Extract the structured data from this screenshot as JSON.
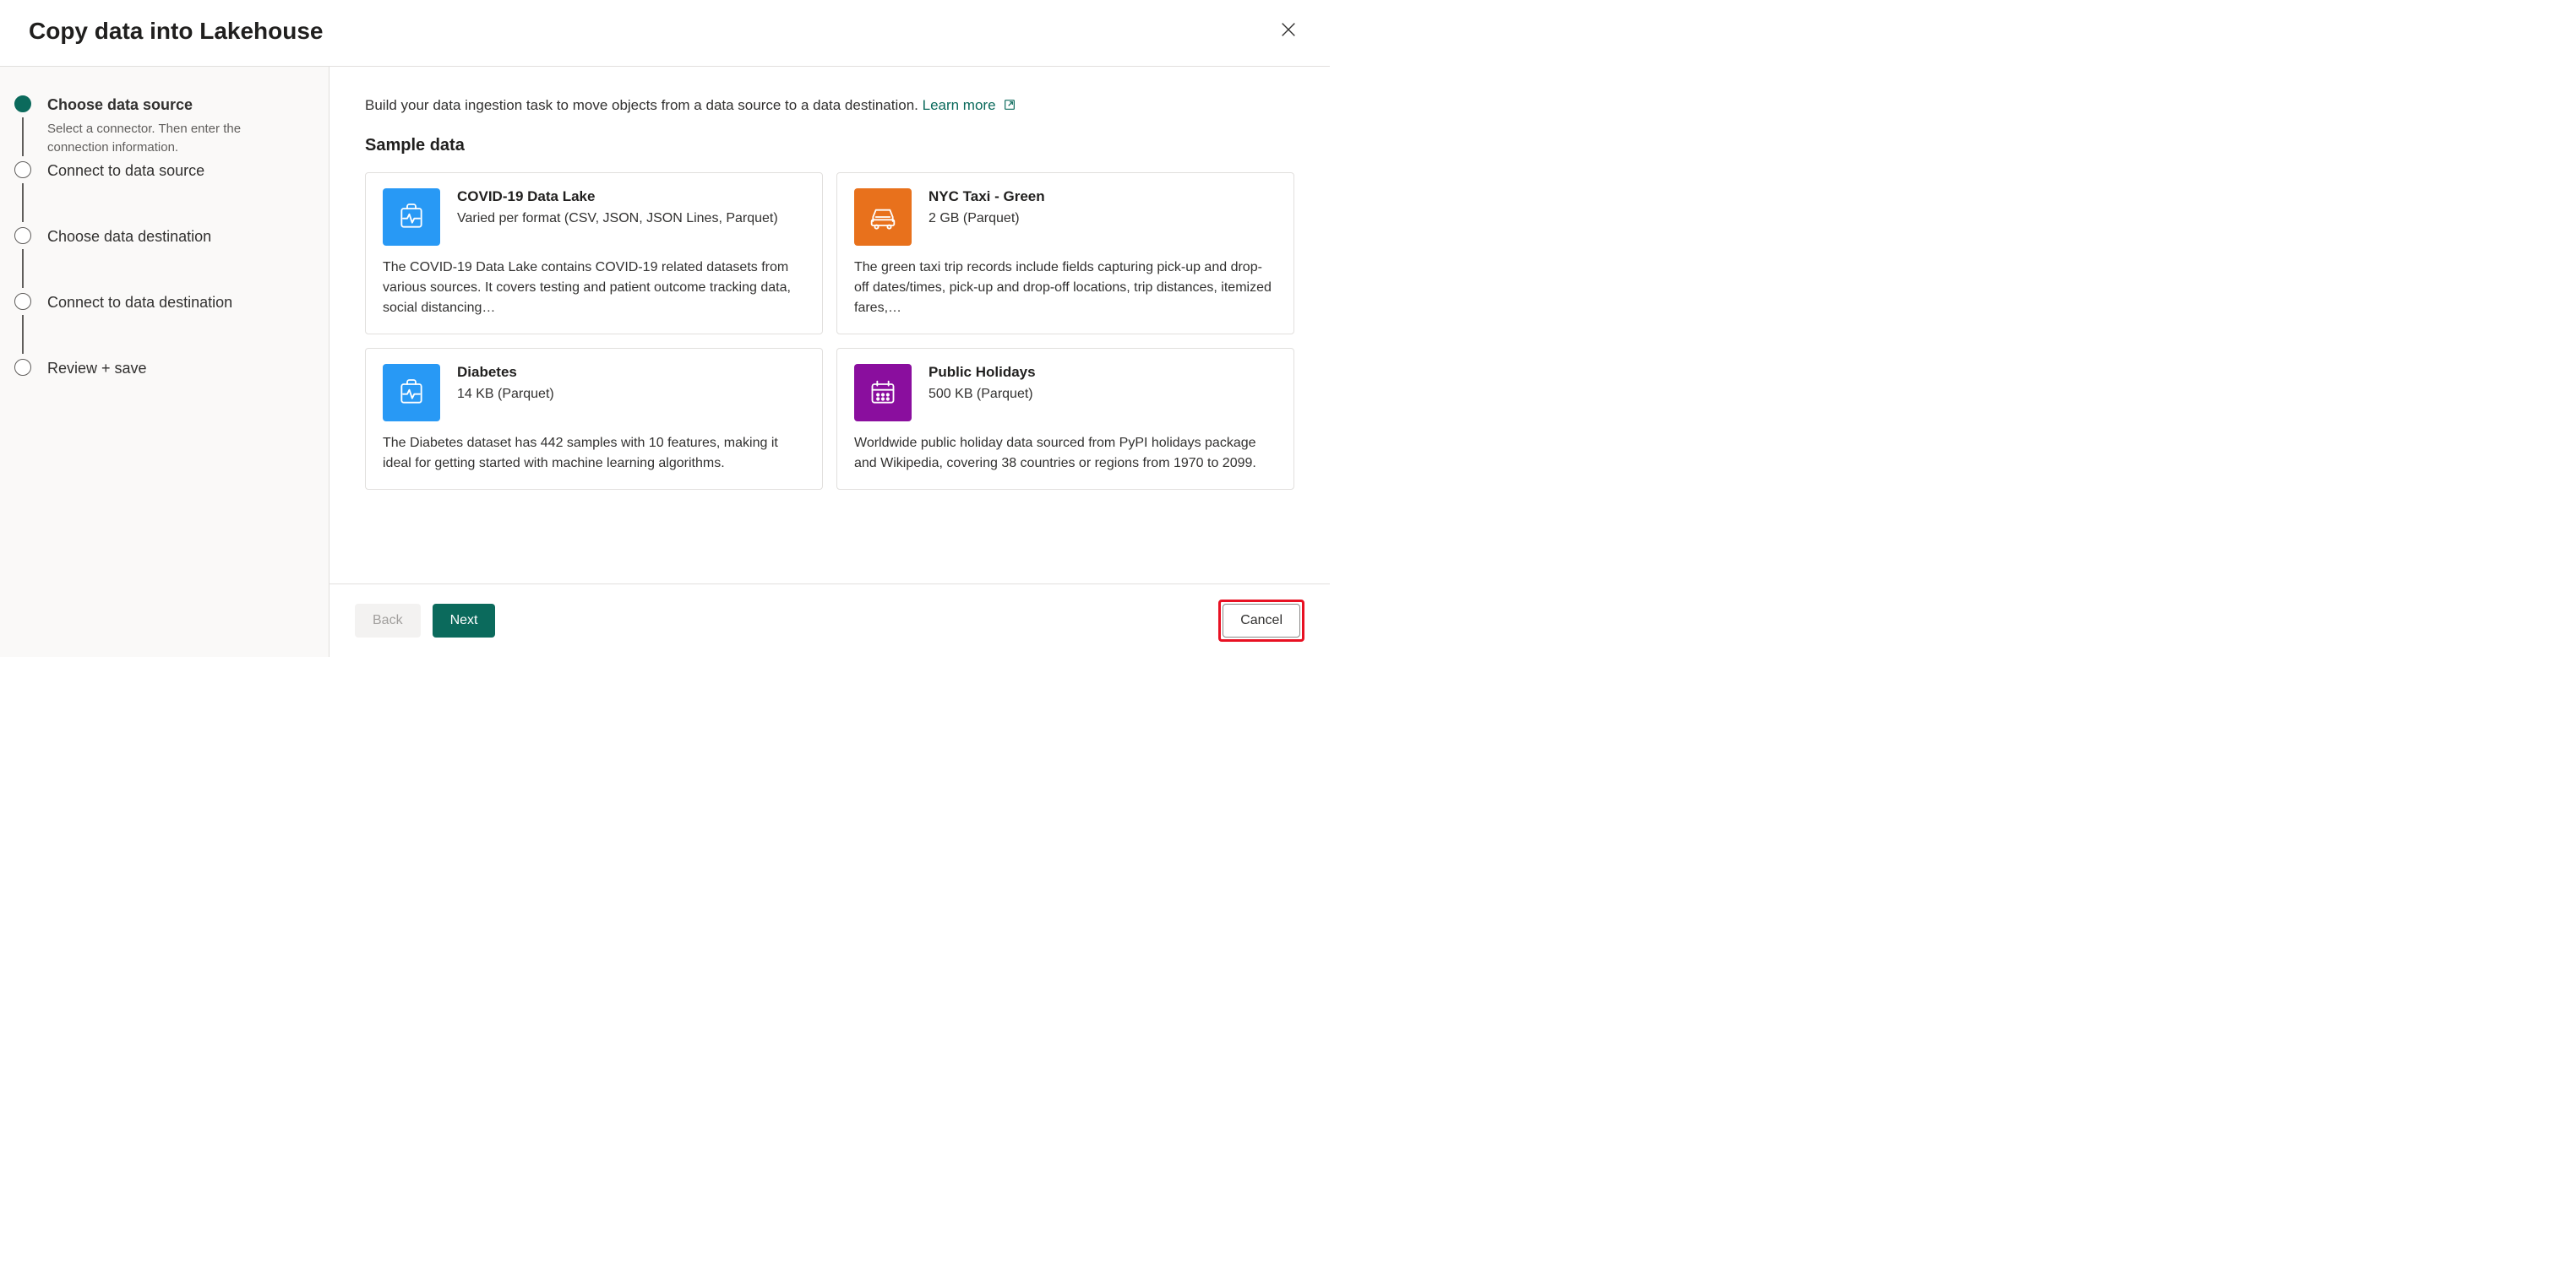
{
  "dialog": {
    "title": "Copy data into Lakehouse"
  },
  "steps": [
    {
      "title": "Choose data source",
      "desc": "Select a connector. Then enter the connection information.",
      "active": true
    },
    {
      "title": "Connect to data source",
      "desc": "",
      "active": false
    },
    {
      "title": "Choose data destination",
      "desc": "",
      "active": false
    },
    {
      "title": "Connect to data destination",
      "desc": "",
      "active": false
    },
    {
      "title": "Review + save",
      "desc": "",
      "active": false
    }
  ],
  "intro": {
    "text": "Build your data ingestion task to move objects from a data source to a data destination. ",
    "learn_more": "Learn more"
  },
  "section_title": "Sample data",
  "cards": [
    {
      "title": "COVID-19 Data Lake",
      "subtitle": "Varied per format (CSV, JSON, JSON Lines, Parquet)",
      "desc": "The COVID-19 Data Lake contains COVID-19 related datasets from various sources. It covers testing and patient outcome tracking data, social distancing…",
      "icon": "health",
      "color": "blue"
    },
    {
      "title": "NYC Taxi - Green",
      "subtitle": "2 GB (Parquet)",
      "desc": "The green taxi trip records include fields capturing pick-up and drop-off dates/times, pick-up and drop-off locations, trip distances, itemized fares,…",
      "icon": "taxi",
      "color": "orange"
    },
    {
      "title": "Diabetes",
      "subtitle": "14 KB (Parquet)",
      "desc": "The Diabetes dataset has 442 samples with 10 features, making it ideal for getting started with machine learning algorithms.",
      "icon": "health",
      "color": "blue"
    },
    {
      "title": "Public Holidays",
      "subtitle": "500 KB (Parquet)",
      "desc": "Worldwide public holiday data sourced from PyPI holidays package and Wikipedia, covering 38 countries or regions from 1970 to 2099.",
      "icon": "calendar",
      "color": "purple"
    }
  ],
  "footer": {
    "back": "Back",
    "next": "Next",
    "cancel": "Cancel"
  }
}
